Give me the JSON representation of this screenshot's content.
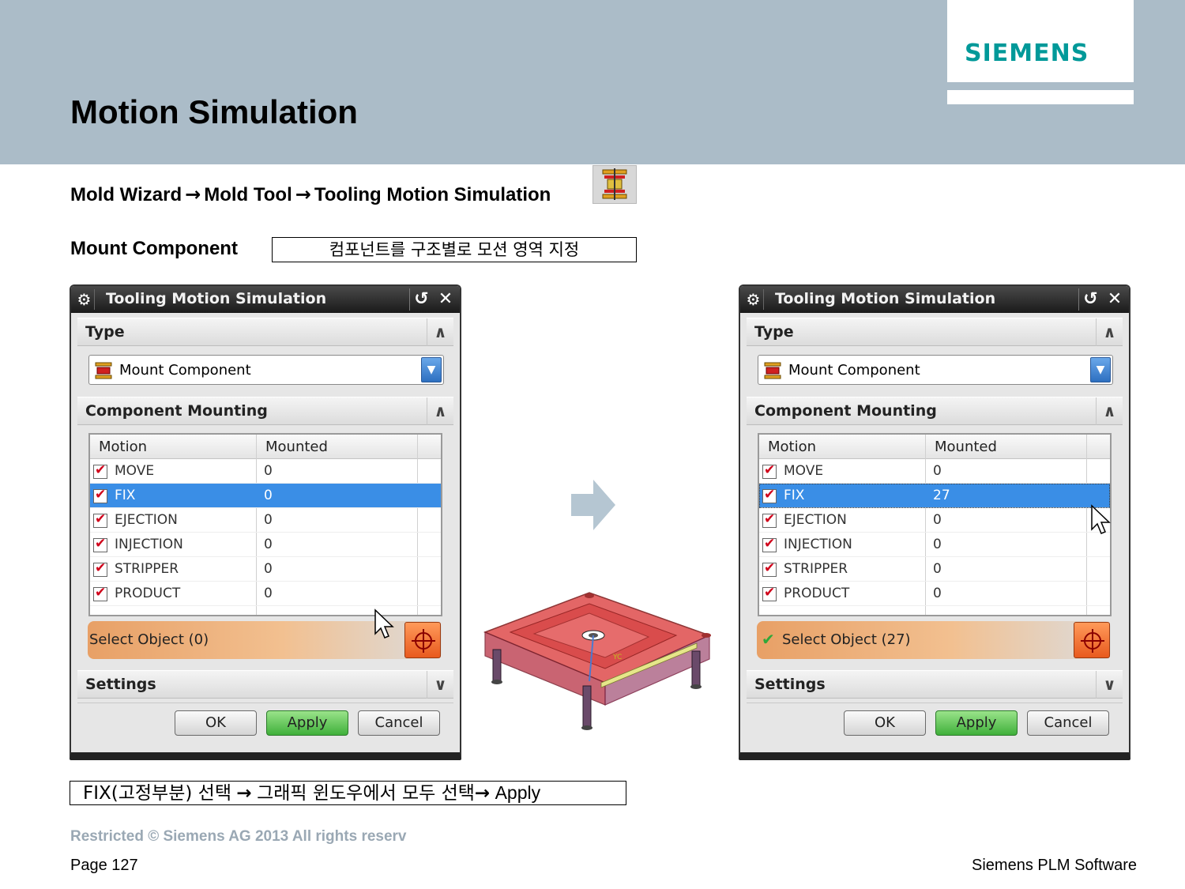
{
  "header": {
    "title": "Motion Simulation",
    "logo": "SIEMENS",
    "logo_color": "#009999",
    "band_color": "#abbcc8"
  },
  "menu_path": {
    "items": [
      "Mold Wizard",
      "Mold Tool",
      "Tooling Motion Simulation"
    ],
    "separator": "→",
    "icon": "tooling-motion-icon"
  },
  "mount": {
    "label": "Mount Component",
    "note": "컴포넌트를 구조별로 모션 영역 지정"
  },
  "dialogs": [
    {
      "title": "Tooling Motion Simulation",
      "type_section": "Type",
      "type_value": "Mount Component",
      "mounting_section": "Component Mounting",
      "columns": [
        "Motion",
        "Mounted"
      ],
      "rows": [
        {
          "motion": "MOVE",
          "mounted": "0",
          "checked": true
        },
        {
          "motion": "FIX",
          "mounted": "0",
          "checked": true,
          "selected": true
        },
        {
          "motion": "EJECTION",
          "mounted": "0",
          "checked": true
        },
        {
          "motion": "INJECTION",
          "mounted": "0",
          "checked": true
        },
        {
          "motion": "STRIPPER",
          "mounted": "0",
          "checked": true
        },
        {
          "motion": "PRODUCT",
          "mounted": "0",
          "checked": true
        }
      ],
      "select_object": "Select Object (0)",
      "select_done": false,
      "settings_section": "Settings",
      "buttons": {
        "ok": "OK",
        "apply": "Apply",
        "cancel": "Cancel"
      }
    },
    {
      "title": "Tooling Motion Simulation",
      "type_section": "Type",
      "type_value": "Mount Component",
      "mounting_section": "Component Mounting",
      "columns": [
        "Motion",
        "Mounted"
      ],
      "rows": [
        {
          "motion": "MOVE",
          "mounted": "0",
          "checked": true
        },
        {
          "motion": "FIX",
          "mounted": "27",
          "checked": true,
          "selected": true
        },
        {
          "motion": "EJECTION",
          "mounted": "0",
          "checked": true
        },
        {
          "motion": "INJECTION",
          "mounted": "0",
          "checked": true
        },
        {
          "motion": "STRIPPER",
          "mounted": "0",
          "checked": true
        },
        {
          "motion": "PRODUCT",
          "mounted": "0",
          "checked": true
        }
      ],
      "select_object": "Select Object (27)",
      "select_done": true,
      "settings_section": "Settings",
      "buttons": {
        "ok": "OK",
        "apply": "Apply",
        "cancel": "Cancel"
      }
    }
  ],
  "model_image": {
    "label": "YC",
    "description_icon": "mold-assembly-3d"
  },
  "instruction": {
    "prefix": "FIX(고정부분) 선택",
    "middle": "그래픽 윈도우에서 모두 선택",
    "suffix": "Apply",
    "arrow": "→"
  },
  "footer": {
    "copyright": "Restricted © Siemens AG 2013 All rights reserv",
    "page": "Page 127",
    "brand": "Siemens PLM Software"
  },
  "colors": {
    "selection": "#3a8ee6",
    "apply_button": "#3fb03a",
    "select_bar": "#e8a066",
    "check": "#d0001a"
  }
}
